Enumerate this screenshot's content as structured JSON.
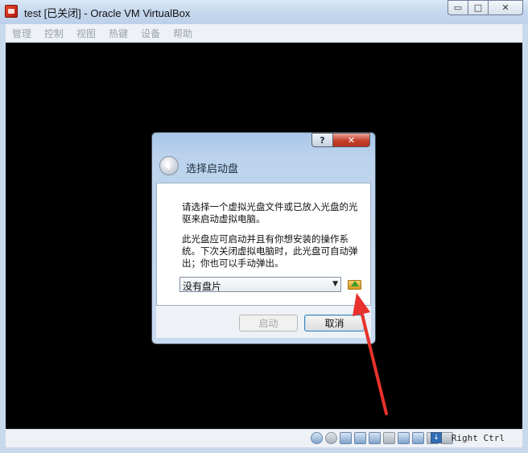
{
  "window": {
    "title": "test [已关闭] - Oracle VM VirtualBox",
    "caption_buttons": {
      "minimize": "▭",
      "maximize": "□",
      "close": "✕"
    }
  },
  "menubar": {
    "items": [
      "管理",
      "控制",
      "视图",
      "热键",
      "设备",
      "帮助"
    ]
  },
  "dialog": {
    "title": "选择启动盘",
    "help_label": "?",
    "close_label": "✕",
    "paragraph1": "请选择一个虚拟光盘文件或已放入光盘的光驱来启动虚拟电脑。",
    "paragraph2": "此光盘应可启动并且有你想安装的操作系统。下次关闭虚拟电脑时，此光盘可自动弹出；你也可以手动弹出。",
    "disk_select": {
      "selected": "没有盘片"
    },
    "buttons": {
      "start": "启动",
      "cancel": "取消"
    }
  },
  "statusbar": {
    "host_key": "Right Ctrl",
    "icons": [
      "hard-disk-icon",
      "optical-drive-icon",
      "audio-icon",
      "network-icon",
      "usb-icon",
      "shared-folders-icon",
      "display-icon",
      "video-capture-icon",
      "cpu-icon",
      "mouse-integration-icon",
      "host-key-icon"
    ]
  },
  "colors": {
    "annotation_arrow": "#e8322b",
    "vm_screen": "#000000"
  }
}
